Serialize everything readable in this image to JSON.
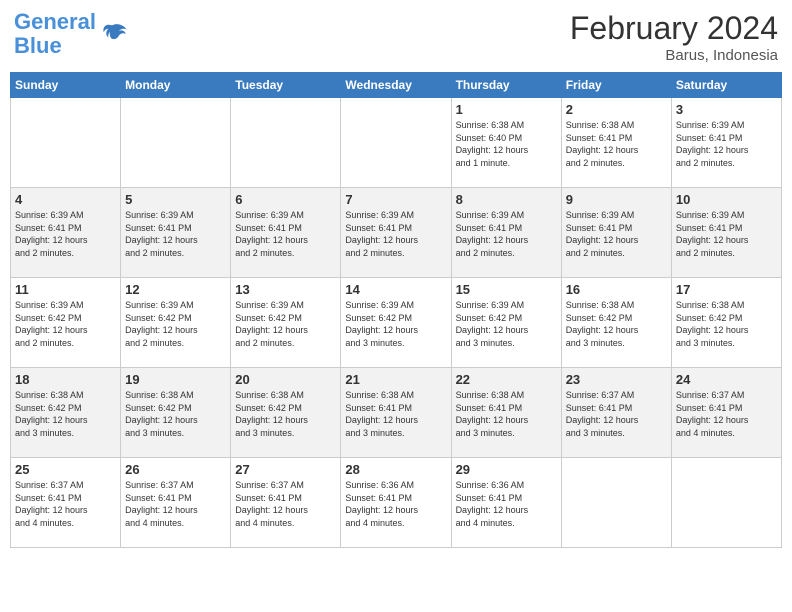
{
  "header": {
    "logo_line1": "General",
    "logo_line2": "Blue",
    "month_year": "February 2024",
    "location": "Barus, Indonesia"
  },
  "days_of_week": [
    "Sunday",
    "Monday",
    "Tuesday",
    "Wednesday",
    "Thursday",
    "Friday",
    "Saturday"
  ],
  "weeks": [
    [
      {
        "day": "",
        "info": ""
      },
      {
        "day": "",
        "info": ""
      },
      {
        "day": "",
        "info": ""
      },
      {
        "day": "",
        "info": ""
      },
      {
        "day": "1",
        "info": "Sunrise: 6:38 AM\nSunset: 6:40 PM\nDaylight: 12 hours\nand 1 minute."
      },
      {
        "day": "2",
        "info": "Sunrise: 6:38 AM\nSunset: 6:41 PM\nDaylight: 12 hours\nand 2 minutes."
      },
      {
        "day": "3",
        "info": "Sunrise: 6:39 AM\nSunset: 6:41 PM\nDaylight: 12 hours\nand 2 minutes."
      }
    ],
    [
      {
        "day": "4",
        "info": "Sunrise: 6:39 AM\nSunset: 6:41 PM\nDaylight: 12 hours\nand 2 minutes."
      },
      {
        "day": "5",
        "info": "Sunrise: 6:39 AM\nSunset: 6:41 PM\nDaylight: 12 hours\nand 2 minutes."
      },
      {
        "day": "6",
        "info": "Sunrise: 6:39 AM\nSunset: 6:41 PM\nDaylight: 12 hours\nand 2 minutes."
      },
      {
        "day": "7",
        "info": "Sunrise: 6:39 AM\nSunset: 6:41 PM\nDaylight: 12 hours\nand 2 minutes."
      },
      {
        "day": "8",
        "info": "Sunrise: 6:39 AM\nSunset: 6:41 PM\nDaylight: 12 hours\nand 2 minutes."
      },
      {
        "day": "9",
        "info": "Sunrise: 6:39 AM\nSunset: 6:41 PM\nDaylight: 12 hours\nand 2 minutes."
      },
      {
        "day": "10",
        "info": "Sunrise: 6:39 AM\nSunset: 6:41 PM\nDaylight: 12 hours\nand 2 minutes."
      }
    ],
    [
      {
        "day": "11",
        "info": "Sunrise: 6:39 AM\nSunset: 6:42 PM\nDaylight: 12 hours\nand 2 minutes."
      },
      {
        "day": "12",
        "info": "Sunrise: 6:39 AM\nSunset: 6:42 PM\nDaylight: 12 hours\nand 2 minutes."
      },
      {
        "day": "13",
        "info": "Sunrise: 6:39 AM\nSunset: 6:42 PM\nDaylight: 12 hours\nand 2 minutes."
      },
      {
        "day": "14",
        "info": "Sunrise: 6:39 AM\nSunset: 6:42 PM\nDaylight: 12 hours\nand 3 minutes."
      },
      {
        "day": "15",
        "info": "Sunrise: 6:39 AM\nSunset: 6:42 PM\nDaylight: 12 hours\nand 3 minutes."
      },
      {
        "day": "16",
        "info": "Sunrise: 6:38 AM\nSunset: 6:42 PM\nDaylight: 12 hours\nand 3 minutes."
      },
      {
        "day": "17",
        "info": "Sunrise: 6:38 AM\nSunset: 6:42 PM\nDaylight: 12 hours\nand 3 minutes."
      }
    ],
    [
      {
        "day": "18",
        "info": "Sunrise: 6:38 AM\nSunset: 6:42 PM\nDaylight: 12 hours\nand 3 minutes."
      },
      {
        "day": "19",
        "info": "Sunrise: 6:38 AM\nSunset: 6:42 PM\nDaylight: 12 hours\nand 3 minutes."
      },
      {
        "day": "20",
        "info": "Sunrise: 6:38 AM\nSunset: 6:42 PM\nDaylight: 12 hours\nand 3 minutes."
      },
      {
        "day": "21",
        "info": "Sunrise: 6:38 AM\nSunset: 6:41 PM\nDaylight: 12 hours\nand 3 minutes."
      },
      {
        "day": "22",
        "info": "Sunrise: 6:38 AM\nSunset: 6:41 PM\nDaylight: 12 hours\nand 3 minutes."
      },
      {
        "day": "23",
        "info": "Sunrise: 6:37 AM\nSunset: 6:41 PM\nDaylight: 12 hours\nand 3 minutes."
      },
      {
        "day": "24",
        "info": "Sunrise: 6:37 AM\nSunset: 6:41 PM\nDaylight: 12 hours\nand 4 minutes."
      }
    ],
    [
      {
        "day": "25",
        "info": "Sunrise: 6:37 AM\nSunset: 6:41 PM\nDaylight: 12 hours\nand 4 minutes."
      },
      {
        "day": "26",
        "info": "Sunrise: 6:37 AM\nSunset: 6:41 PM\nDaylight: 12 hours\nand 4 minutes."
      },
      {
        "day": "27",
        "info": "Sunrise: 6:37 AM\nSunset: 6:41 PM\nDaylight: 12 hours\nand 4 minutes."
      },
      {
        "day": "28",
        "info": "Sunrise: 6:36 AM\nSunset: 6:41 PM\nDaylight: 12 hours\nand 4 minutes."
      },
      {
        "day": "29",
        "info": "Sunrise: 6:36 AM\nSunset: 6:41 PM\nDaylight: 12 hours\nand 4 minutes."
      },
      {
        "day": "",
        "info": ""
      },
      {
        "day": "",
        "info": ""
      }
    ]
  ]
}
